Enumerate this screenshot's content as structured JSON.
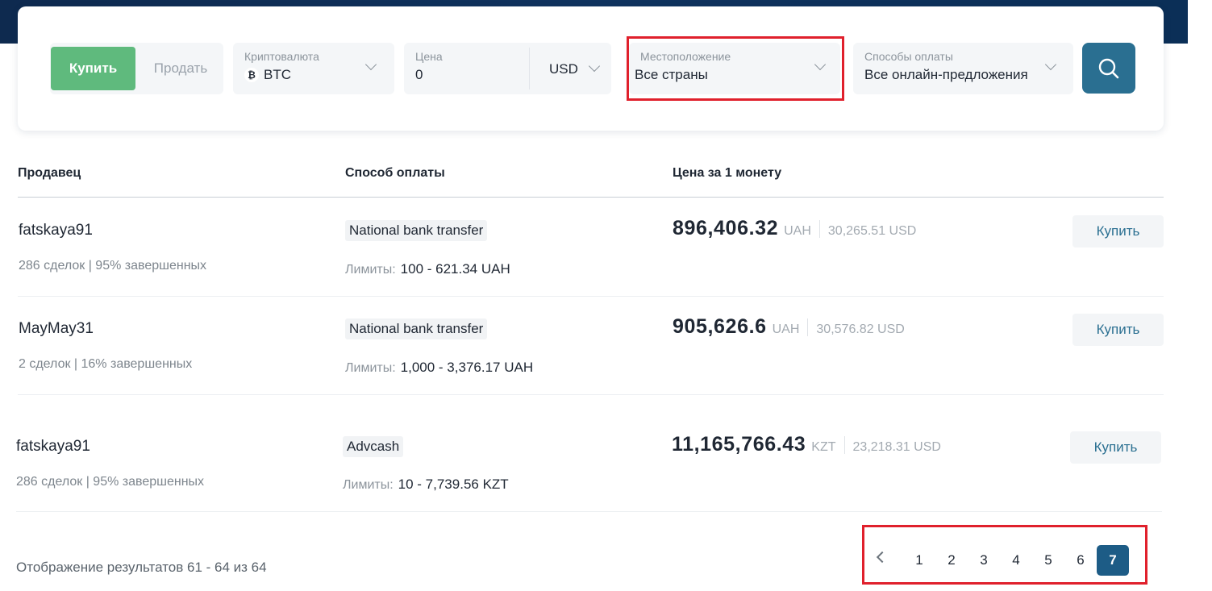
{
  "filters": {
    "buy_label": "Купить",
    "sell_label": "Продать",
    "crypto": {
      "label": "Криптовалюта",
      "value": "BTC",
      "icon": "bitcoin-icon"
    },
    "price": {
      "label": "Цена",
      "value": "0",
      "currency": "USD"
    },
    "location": {
      "label": "Местоположение",
      "value": "Все страны"
    },
    "payment": {
      "label": "Способы оплаты",
      "value": "Все онлайн-предложения"
    },
    "search_icon": "search-icon"
  },
  "table": {
    "headers": {
      "seller": "Продавец",
      "method": "Способ оплаты",
      "price": "Цена за 1 монету"
    },
    "limits_label": "Лимиты:",
    "rows": [
      {
        "seller": "fatskaya91",
        "stats": "286 сделок | 95% завершенных",
        "method": "National bank transfer",
        "limits": "100 - 621.34 UAH",
        "price": "896,406.32",
        "currency": "UAH",
        "usd": "30,265.51 USD",
        "buy": "Купить"
      },
      {
        "seller": "MayMay31",
        "stats": "2 сделок | 16% завершенных",
        "method": "National bank transfer",
        "limits": "1,000 - 3,376.17 UAH",
        "price": "905,626.6",
        "currency": "UAH",
        "usd": "30,576.82 USD",
        "buy": "Купить"
      },
      {
        "seller": "fatskaya91",
        "stats": "286 сделок | 95% завершенных",
        "method": "Advcash",
        "limits": "10 - 7,739.56 KZT",
        "price": "11,165,766.43",
        "currency": "KZT",
        "usd": "23,218.31 USD",
        "buy": "Купить"
      }
    ]
  },
  "footer": {
    "results_text": "Отображение результатов 61 - 64 из 64",
    "pages": [
      "1",
      "2",
      "3",
      "4",
      "5",
      "6",
      "7"
    ],
    "current_page": "7"
  },
  "colors": {
    "buy_green": "#5fba7d",
    "accent_blue": "#2a6f91",
    "highlight_red": "#e0202c"
  }
}
